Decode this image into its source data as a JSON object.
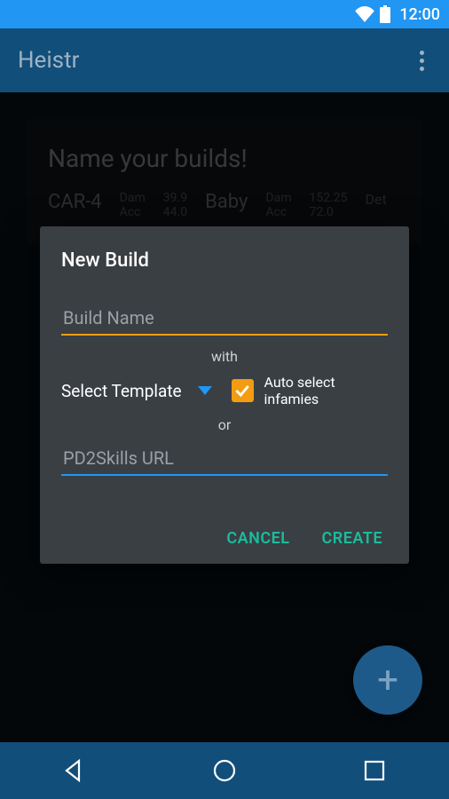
{
  "status": {
    "time": "12:00"
  },
  "appbar": {
    "title": "Heistr"
  },
  "bg": {
    "heading": "Name your builds!",
    "w1": "CAR-4",
    "w1_dam_label": "Dam",
    "w1_dam": "39.9",
    "w1_acc_label": "Acc",
    "w1_acc": "44.0",
    "w2": "Baby",
    "w2_dam_label": "Dam",
    "w2_dam": "152.25",
    "w2_acc_label": "Acc",
    "w2_acc": "72.0",
    "det": "Det"
  },
  "dialog": {
    "title": "New Build",
    "build_name_placeholder": "Build Name",
    "with": "with",
    "select_template": "Select Template",
    "auto_infamies": "Auto select infamies",
    "or": "or",
    "url_placeholder": "PD2Skills URL",
    "cancel": "CANCEL",
    "create": "CREATE"
  },
  "fab": {
    "plus": "+"
  }
}
